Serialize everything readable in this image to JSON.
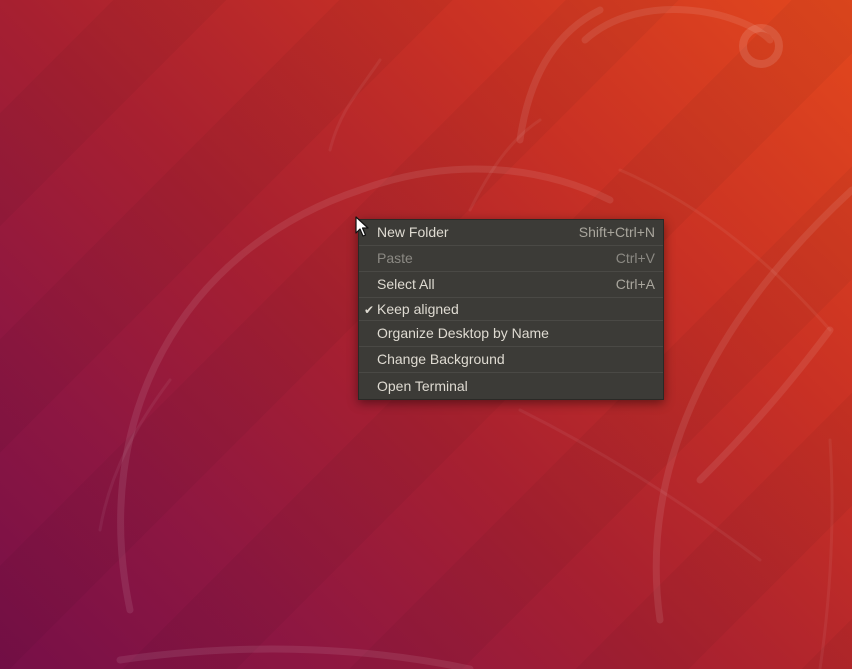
{
  "desktop": {
    "colors": {
      "gradient_top_right": "#e3481d",
      "gradient_mid": "#a72030",
      "gradient_bottom_left": "#760f48",
      "menu_background": "#3c3b37",
      "menu_text": "#dfdbd2",
      "menu_text_disabled": "#8b8983"
    }
  },
  "context_menu": {
    "items": [
      {
        "label": "New Folder",
        "shortcut": "Shift+Ctrl+N",
        "enabled": true,
        "checked": false
      },
      {
        "label": "Paste",
        "shortcut": "Ctrl+V",
        "enabled": false,
        "checked": false
      },
      {
        "label": "Select All",
        "shortcut": "Ctrl+A",
        "enabled": true,
        "checked": false
      },
      {
        "label": "Keep aligned",
        "shortcut": "",
        "enabled": true,
        "checked": true,
        "check_icon": "checkmark-icon"
      },
      {
        "label": "Organize Desktop by Name",
        "shortcut": "",
        "enabled": true,
        "checked": false
      },
      {
        "label": "Change Background",
        "shortcut": "",
        "enabled": true,
        "checked": false
      },
      {
        "label": "Open Terminal",
        "shortcut": "",
        "enabled": true,
        "checked": false
      }
    ],
    "check_glyph": "✔"
  }
}
